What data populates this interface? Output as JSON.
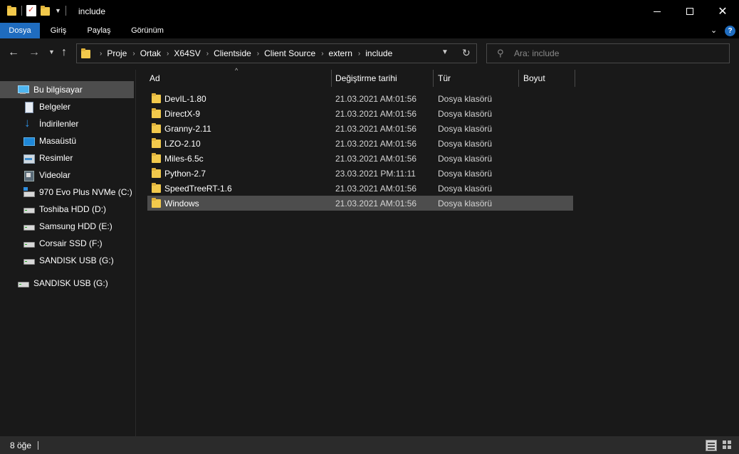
{
  "window": {
    "title": "include",
    "minimize_glyph": "",
    "close_glyph": "✕"
  },
  "ribbon": {
    "tabs": [
      {
        "label": "Dosya",
        "active": true
      },
      {
        "label": "Giriş",
        "active": false
      },
      {
        "label": "Paylaş",
        "active": false
      },
      {
        "label": "Görünüm",
        "active": false
      }
    ],
    "help_glyph": "?",
    "expand_glyph": "⌄"
  },
  "navigation": {
    "back_glyph": "←",
    "forward_glyph": "→",
    "recent_glyph": "⌄",
    "up_glyph": "↑",
    "breadcrumbs": [
      "Proje",
      "Ortak",
      "X64SV",
      "Clientside",
      "Client Source",
      "extern",
      "include"
    ],
    "chevron_glyph": "›",
    "dropdown_glyph": "⌄",
    "refresh_glyph": "↻"
  },
  "search": {
    "placeholder": "Ara: include",
    "icon_glyph": "⌕"
  },
  "sidebar": {
    "items": [
      {
        "label": "Bu bilgisayar",
        "icon": "computer-icon",
        "selected": true
      },
      {
        "label": "Belgeler",
        "icon": "documents-icon"
      },
      {
        "label": "İndirilenler",
        "icon": "downloads-icon"
      },
      {
        "label": "Masaüstü",
        "icon": "desktop-icon"
      },
      {
        "label": "Resimler",
        "icon": "pictures-icon"
      },
      {
        "label": "Videolar",
        "icon": "videos-icon"
      },
      {
        "label": "970 Evo Plus NVMe (C:)",
        "icon": "system-drive-icon"
      },
      {
        "label": "Toshiba HDD (D:)",
        "icon": "drive-icon"
      },
      {
        "label": "Samsung HDD (E:)",
        "icon": "drive-icon"
      },
      {
        "label": "Corsair SSD (F:)",
        "icon": "drive-icon"
      },
      {
        "label": "SANDISK USB (G:)",
        "icon": "drive-icon"
      },
      {
        "label": "SANDISK USB (G:)",
        "icon": "usb-drive-icon"
      }
    ]
  },
  "columns": {
    "name": "Ad",
    "date": "Değiştirme tarihi",
    "type": "Tür",
    "size": "Boyut",
    "sort_glyph": "^"
  },
  "files": [
    {
      "name": "DevIL-1.80",
      "date": "21.03.2021 AM:01:56",
      "type": "Dosya klasörü"
    },
    {
      "name": "DirectX-9",
      "date": "21.03.2021 AM:01:56",
      "type": "Dosya klasörü"
    },
    {
      "name": "Granny-2.11",
      "date": "21.03.2021 AM:01:56",
      "type": "Dosya klasörü"
    },
    {
      "name": "LZO-2.10",
      "date": "21.03.2021 AM:01:56",
      "type": "Dosya klasörü"
    },
    {
      "name": "Miles-6.5c",
      "date": "21.03.2021 AM:01:56",
      "type": "Dosya klasörü"
    },
    {
      "name": "Python-2.7",
      "date": "23.03.2021 PM:11:11",
      "type": "Dosya klasörü"
    },
    {
      "name": "SpeedTreeRT-1.6",
      "date": "21.03.2021 AM:01:56",
      "type": "Dosya klasörü"
    },
    {
      "name": "Windows",
      "date": "21.03.2021 AM:01:56",
      "type": "Dosya klasörü",
      "selected": true
    }
  ],
  "status": {
    "item_count": "8 öğe"
  },
  "colors": {
    "accent": "#1f6cbf",
    "folder": "#f2c94c",
    "selection": "#4d4d4d",
    "background": "#191919"
  }
}
